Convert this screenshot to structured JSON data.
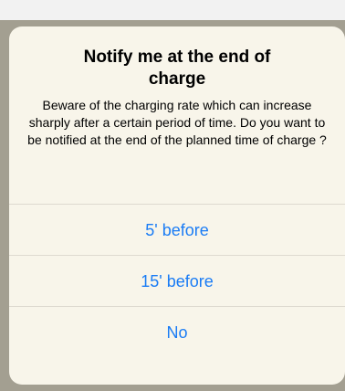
{
  "alert": {
    "title": "Notify me at the end of charge",
    "message": "Beware of the charging rate which can increase sharply after a certain period of time. Do you want to be notified at the end of the planned time of charge ?",
    "buttons": [
      {
        "label": "5' before"
      },
      {
        "label": "15' before"
      },
      {
        "label": "No"
      }
    ]
  },
  "colors": {
    "accent": "#1a7cf5",
    "alert_background": "#f8f5ea",
    "backdrop": "#a39f91"
  }
}
